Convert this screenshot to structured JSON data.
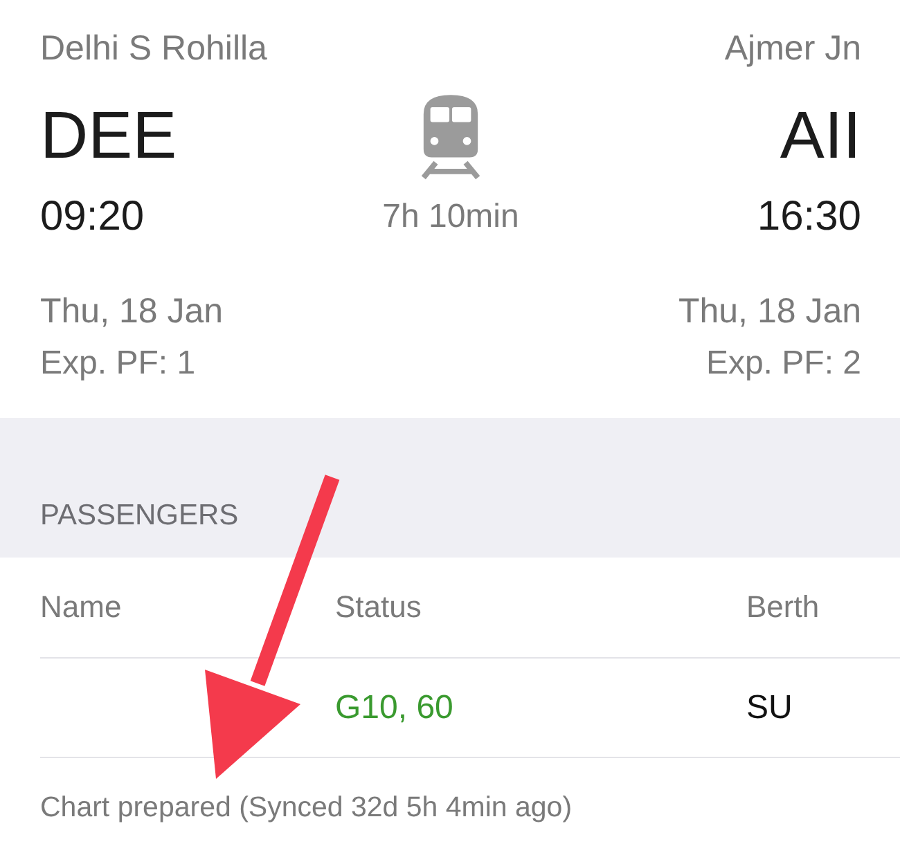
{
  "journey": {
    "from": {
      "name": "Delhi S Rohilla",
      "code": "DEE",
      "time": "09:20",
      "date": "Thu, 18 Jan",
      "platform": "Exp. PF: 1"
    },
    "to": {
      "name": "Ajmer Jn",
      "code": "AII",
      "time": "16:30",
      "date": "Thu, 18 Jan",
      "platform": "Exp. PF: 2"
    },
    "duration": "7h 10min"
  },
  "passengers": {
    "title": "PASSENGERS",
    "columns": [
      "Name",
      "Status",
      "Berth"
    ],
    "rows": [
      {
        "status": "G10, 60",
        "color": "#3a9a2f",
        "berth": "SU"
      }
    ]
  },
  "chart_status": "Chart prepared (Synced 32d 5h 4min ago)"
}
